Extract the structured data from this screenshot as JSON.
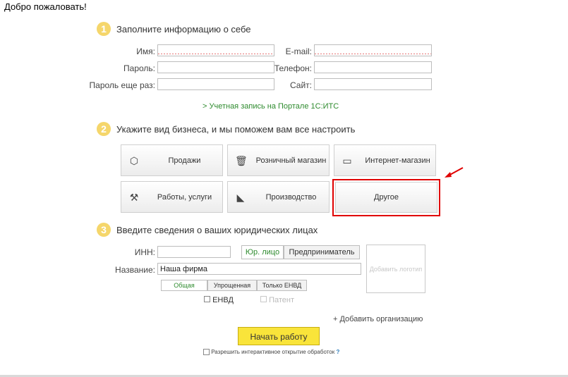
{
  "header": {
    "welcome": "Добро пожаловать!"
  },
  "step1": {
    "number": "1",
    "title": "Заполните информацию о себе",
    "fields": {
      "name_label": "Имя:",
      "email_label": "E-mail:",
      "password_label": "Пароль:",
      "phone_label": "Телефон:",
      "password_repeat_label": "Пароль еще раз:",
      "site_label": "Сайт:"
    },
    "portal_link": "Учетная запись на Портале 1С:ИТС"
  },
  "step2": {
    "number": "2",
    "title": "Укажите вид бизнеса, и мы поможем вам все настроить",
    "tiles": [
      "Продажи",
      "Розничный магазин",
      "Интернет-магазин",
      "Работы, услуги",
      "Производство",
      "Другое"
    ]
  },
  "step3": {
    "number": "3",
    "title": "Введите сведения о ваших юридических лицах",
    "inn_label": "ИНН:",
    "inn_value": "",
    "entity_types": [
      "Юр. лицо",
      "Предприниматель"
    ],
    "name_label": "Название:",
    "name_value": "Наша фирма",
    "tax_systems": [
      "Общая",
      "Упрощенная",
      "Только ЕНВД"
    ],
    "envd_label": "ЕНВД",
    "patent_label": "Патент",
    "add_logo": "Добавить логотип",
    "add_org": "+ Добавить организацию"
  },
  "footer": {
    "start_button": "Начать работу",
    "allow_label": "Разрешить интерактивное открытие обработок",
    "help": "?"
  },
  "colors": {
    "accent_green": "#2e8b2e",
    "step_yellow": "#f5d66b",
    "start_yellow": "#f9e43a",
    "highlight_red": "#e00000"
  },
  "icons": [
    "box-icon",
    "basket-icon",
    "monitor-icon",
    "tools-icon",
    "factory-icon",
    "arrow-icon"
  ]
}
